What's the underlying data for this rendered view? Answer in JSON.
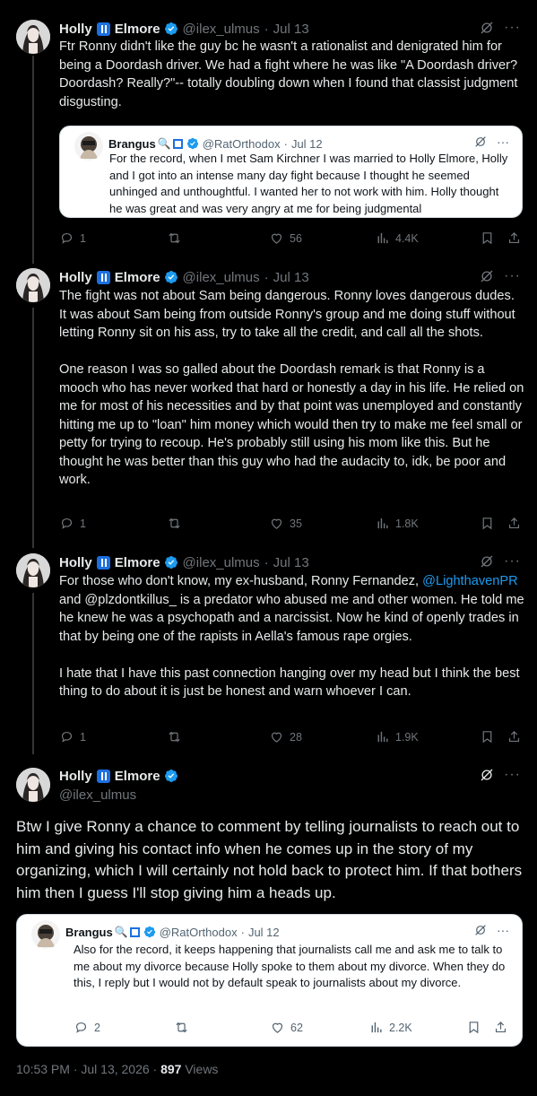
{
  "user": {
    "display_first": "Holly",
    "display_last": "Elmore",
    "handle": "@ilex_ulmus"
  },
  "quoted_user": {
    "display": "Brangus",
    "handle": "@RatOrthodox"
  },
  "tweets": [
    {
      "date": "Jul 13",
      "text": "Ftr Ronny didn't like the guy bc he wasn't a rationalist and denigrated him for being a Doordash driver. We had a fight where he was like \"A Doordash driver? Doordash? Really?\"-- totally doubling down when I found that classist judgment disgusting.",
      "quote": {
        "date": "Jul 12",
        "text": "For the record, when I met Sam Kirchner I was married to Holly Elmore, Holly and I got into an intense many day fight because I thought he seemed unhinged and unthoughtful. I wanted her to not work with him. Holly thought he was great and was very angry at me for being judgmental"
      },
      "replies": "1",
      "retweets": "",
      "likes": "56",
      "views": "4.4K"
    },
    {
      "date": "Jul 13",
      "text": "The fight was not about Sam being dangerous. Ronny loves dangerous dudes. It was about Sam being from outside Ronny's group and me doing stuff without letting Ronny sit on his ass, try to take all the credit, and call all the shots.\n\nOne reason I was so galled about the Doordash remark is that Ronny is a mooch who has never worked that hard or honestly a day in his life. He relied on me for most of his necessities and by that point was unemployed and constantly hitting me up to \"loan\" him money which would then try to make me feel small or petty for trying to recoup. He's probably still using his mom like this. But he thought he was better than this guy who had the audacity to, idk, be poor and work.",
      "replies": "1",
      "retweets": "",
      "likes": "35",
      "views": "1.8K"
    },
    {
      "date": "Jul 13",
      "text_a": "For those who don't know, my ex-husband, Ronny Fernandez, ",
      "mention": "@LighthavenPR",
      "text_b": " and @plzdontkillus_ is a predator who abused me and other women. He told me he knew he was a psychopath and a narcissist. Now he kind of openly trades in that by being one of the rapists in Aella's famous rape orgies.\n\nI hate that I have this past connection hanging over my head but I think the best thing to do about it is just be honest and warn whoever I can.",
      "replies": "1",
      "retweets": "",
      "likes": "28",
      "views": "1.9K"
    }
  ],
  "main": {
    "text": "Btw I give Ronny a chance to comment by telling journalists to reach out to him and giving his contact info when he comes up in the story of my organizing, which I will certainly not hold back to protect him. If that bothers him then I guess I'll stop giving him a heads up.",
    "quote": {
      "date": "Jul 12",
      "text": "Also for the record, it keeps happening that journalists call me and ask me to talk to me about my divorce because Holly spoke to them about my divorce. When they do this, I reply but I would not by default speak to journalists about my divorce.",
      "replies": "2",
      "likes": "62",
      "views": "2.2K"
    },
    "timestamp": "10:53 PM · Jul 13, 2026 · ",
    "views_count": "897",
    "views_label": " Views"
  },
  "colors": {
    "background": "#000000",
    "text": "#e7e9ea",
    "muted": "#71767b",
    "link": "#1d9bf0",
    "verified": "#1d9bf0"
  }
}
